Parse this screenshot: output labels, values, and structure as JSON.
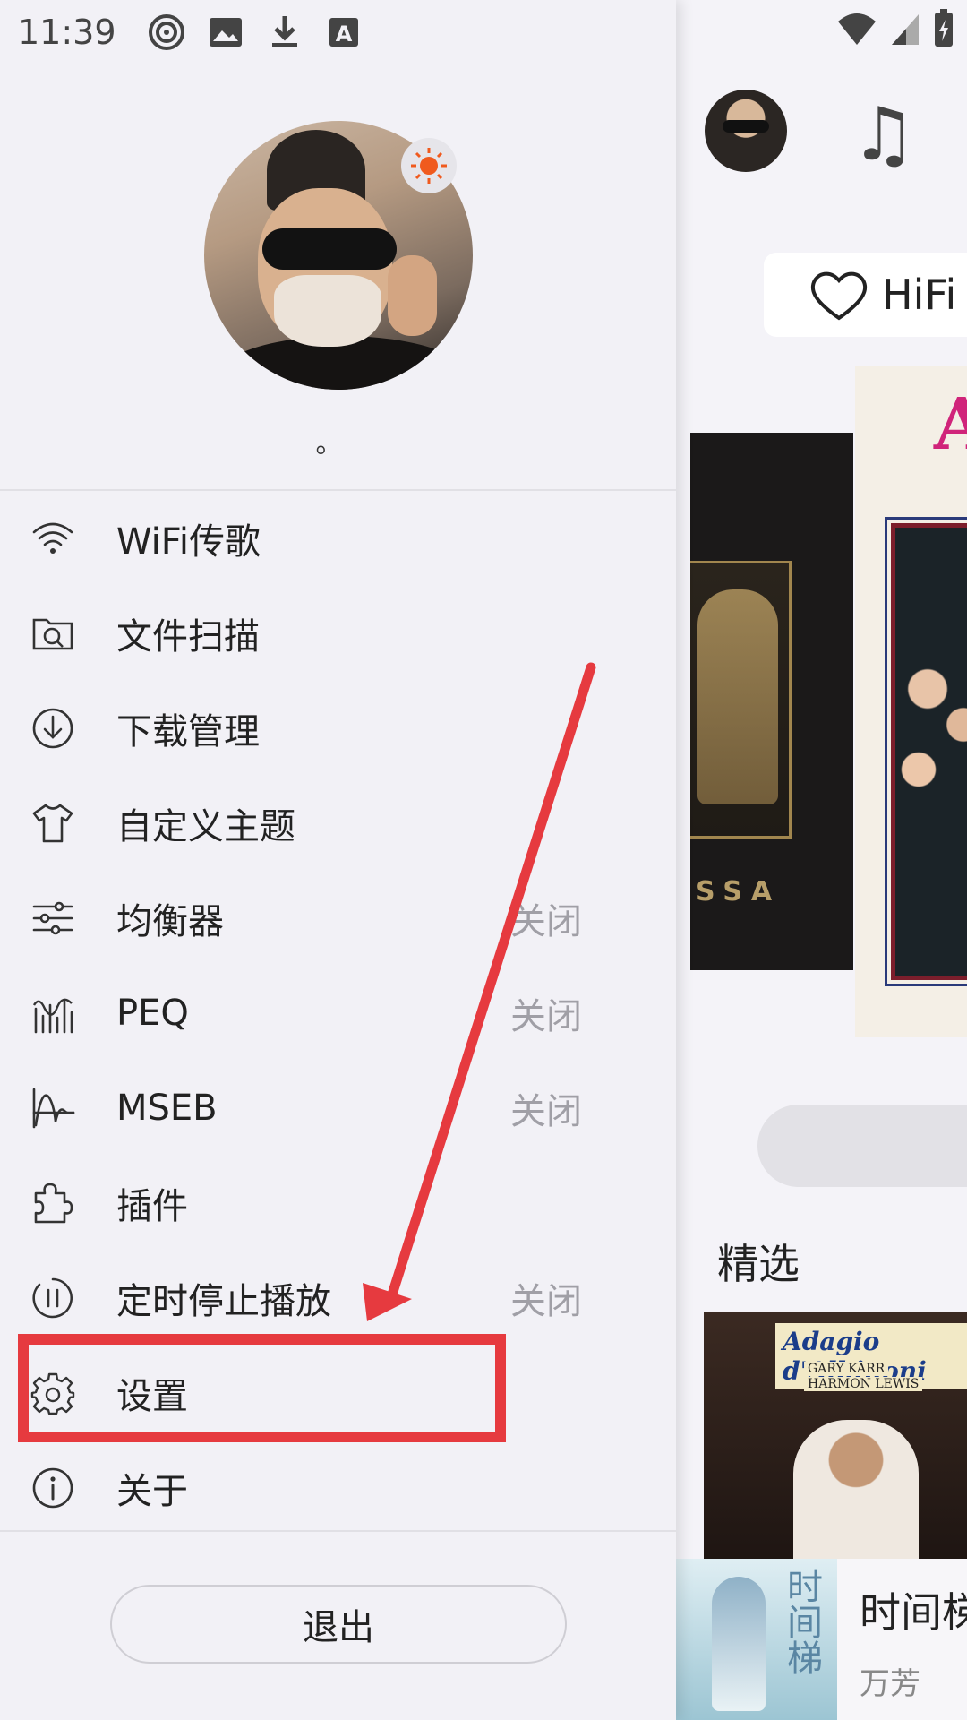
{
  "status_bar": {
    "time": "11:39",
    "left_icons": [
      "nfc-icon",
      "image-icon",
      "download-icon",
      "text-icon"
    ],
    "right_icons": [
      "wifi-icon",
      "signal-icon",
      "battery-icon"
    ]
  },
  "profile": {
    "username": "。",
    "badge": "sun-icon",
    "badge_color": "#f05a1e"
  },
  "menu": [
    {
      "icon": "wifi-icon",
      "label": "WiFi传歌",
      "status": ""
    },
    {
      "icon": "file-scan-icon",
      "label": "文件扫描",
      "status": ""
    },
    {
      "icon": "download-circle-icon",
      "label": "下载管理",
      "status": ""
    },
    {
      "icon": "tshirt-icon",
      "label": "自定义主题",
      "status": ""
    },
    {
      "icon": "sliders-icon",
      "label": "均衡器",
      "status": "关闭"
    },
    {
      "icon": "peq-icon",
      "label": "PEQ",
      "status": "关闭"
    },
    {
      "icon": "mseb-icon",
      "label": "MSEB",
      "status": "关闭"
    },
    {
      "icon": "puzzle-icon",
      "label": "插件",
      "status": ""
    },
    {
      "icon": "timer-icon",
      "label": "定时停止播放",
      "status": "关闭"
    },
    {
      "icon": "gear-icon",
      "label": "设置",
      "status": ""
    },
    {
      "icon": "info-icon",
      "label": "关于",
      "status": ""
    }
  ],
  "logout_label": "退出",
  "background": {
    "hifi_label": "HiFi⁠",
    "featured_label": "精选",
    "album_cover_title": "Adagio d'Albinoni",
    "album_cover_line1": "GARY KARR",
    "album_cover_line2": "HARMON LEWIS",
    "left_cover_text": "SSA",
    "mini_player": {
      "title": "时间梯",
      "artist": "万芳",
      "cover_text": "时间梯"
    }
  },
  "annotation": {
    "color": "#e63a3f",
    "target": "设置"
  }
}
